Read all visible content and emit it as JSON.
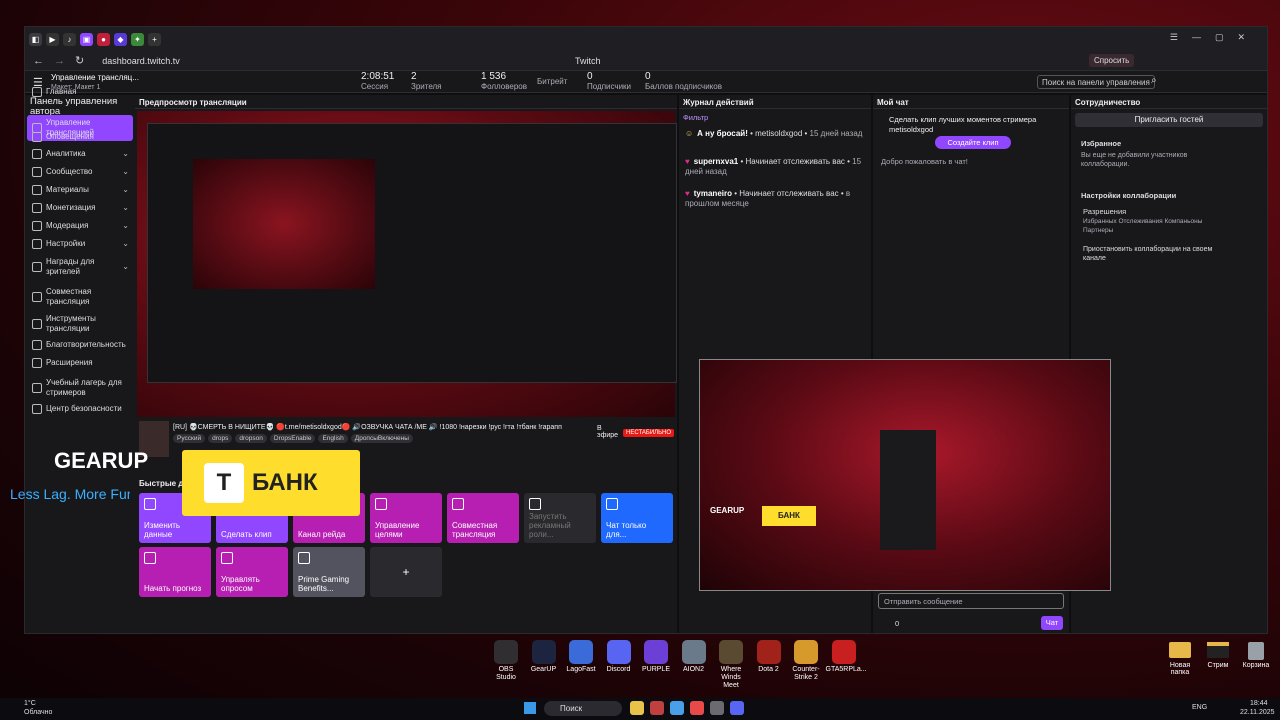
{
  "browser": {
    "url": "dashboard.twitch.tv",
    "title": "Twitch",
    "ask_label": "Спросить"
  },
  "header": {
    "channel": "Управление трансляц...",
    "layout": "Макет: Макет 1",
    "search_placeholder": "Поиск на панели управления",
    "stats": [
      {
        "value": "2:08:51",
        "label": "Сессия"
      },
      {
        "value": "2",
        "label": "Зрителя"
      },
      {
        "value": "1 536",
        "label": "Фолловеров"
      },
      {
        "value": "",
        "label": "Битрейт"
      },
      {
        "value": "0",
        "label": "Подписчики"
      },
      {
        "value": "0",
        "label": "Баллов подписчиков"
      }
    ]
  },
  "sidebar": {
    "title": "Панель управления автора",
    "items": [
      "Главная",
      "Управление трансляцией",
      "Оповещения",
      "Аналитика",
      "Сообщество",
      "Материалы",
      "Монетизация",
      "Модерация",
      "Настройки",
      "Награды для зрителей",
      "Совместная трансляция",
      "Инструменты трансляции",
      "Благотворительность",
      "Расширения",
      "Учебный лагерь для стримеров",
      "Центр безопасности"
    ]
  },
  "preview": {
    "title": "Предпросмотр трансляции",
    "stream_title": "[RU] 💀СМЕРТЬ В НИЩИТЕ💀 🔴t.me/metisoldxgod🔴 🔊ОЗВУЧКА ЧАТА /ME 🔊 !1080 !нарезки !рус !гта !тбанк !гарапп",
    "tags": [
      "Русский",
      "drops",
      "dropson",
      "DropsEnable",
      "English",
      "ДропсыВключены"
    ],
    "live_label": "В эфире",
    "status": "НЕСТАБИЛЬНО"
  },
  "quick": {
    "title": "Быстрые действия",
    "tiles": [
      {
        "label": "Изменить данные",
        "color": "#9147ff"
      },
      {
        "label": "Сделать клип",
        "color": "#9147ff"
      },
      {
        "label": "Канал рейда",
        "color": "#b71fb2"
      },
      {
        "label": "Управление целями",
        "color": "#b71fb2"
      },
      {
        "label": "Совместная трансляция",
        "color": "#b71fb2"
      },
      {
        "label": "Запустить рекламный роли...",
        "color": "#2a2a2e"
      },
      {
        "label": "Чат только для...",
        "color": "#1f69ff"
      },
      {
        "label": "Начать прогноз",
        "color": "#b71fb2"
      },
      {
        "label": "Управлять опросом",
        "color": "#b71fb2"
      },
      {
        "label": "Prime Gaming Benefits...",
        "color": "#53535f"
      },
      {
        "label": "+",
        "color": "#2a2a2e"
      }
    ]
  },
  "activity": {
    "title": "Журнал действий",
    "filter": "Фильтр",
    "items": [
      {
        "name": "А ну бросай!",
        "action": "• metisoldxgod •",
        "time": "15 дней назад"
      },
      {
        "name": "supernxva1",
        "action": "• Начинает отслеживать вас •",
        "time": "15 дней назад"
      },
      {
        "name": "tymaneiro",
        "action": "• Начинает отслеживать вас •",
        "time": "в прошлом месяце"
      }
    ]
  },
  "chat": {
    "title": "Мой чат",
    "promo": "Сделать клип лучших моментов стримера metisoldxgod",
    "clip_button": "Создайте клип",
    "welcome": "Добро пожаловать в чат!",
    "input_placeholder": "Отправить сообщение",
    "send": "Чат",
    "points": "0"
  },
  "collab": {
    "title": "Сотрудничество",
    "invite": "Пригласить гостей",
    "fav_title": "Избранное",
    "fav_text": "Вы еще не добавили участников коллаборации.",
    "settings": "Настройки коллаборации",
    "perm_title": "Разрешения",
    "perm_text": "Избранных Отслеживания Компаньоны Партнеры",
    "pause_text": "Приостановить коллаборации на своем канале"
  },
  "overlay": {
    "brand": "GEARUP",
    "slogan": "Less Lag. More Fun.",
    "bank": "БАНК"
  },
  "dock": [
    {
      "label": "OBS Studio",
      "color": "#302e31"
    },
    {
      "label": "GearUP",
      "color": "#1c2440"
    },
    {
      "label": "LagoFast",
      "color": "#3a6bd8"
    },
    {
      "label": "Discord",
      "color": "#5865f2"
    },
    {
      "label": "PURPLE",
      "color": "#6c3fd6"
    },
    {
      "label": "AION2",
      "color": "#6a7a8a"
    },
    {
      "label": "Where Winds Meet",
      "color": "#5a4a32"
    },
    {
      "label": "Dota 2",
      "color": "#a0221a"
    },
    {
      "label": "Counter-Strike 2",
      "color": "#d69a2c"
    },
    {
      "label": "GTA5RPLa...",
      "color": "#c82020"
    }
  ],
  "desktop": [
    {
      "label": "Новая папка"
    },
    {
      "label": "Стрим"
    },
    {
      "label": "Корзина"
    }
  ],
  "taskbar": {
    "temp": "1°C",
    "weather": "Облачно",
    "search": "Поиск",
    "lang": "ENG",
    "time": "18:44",
    "date": "22.11.2025"
  }
}
